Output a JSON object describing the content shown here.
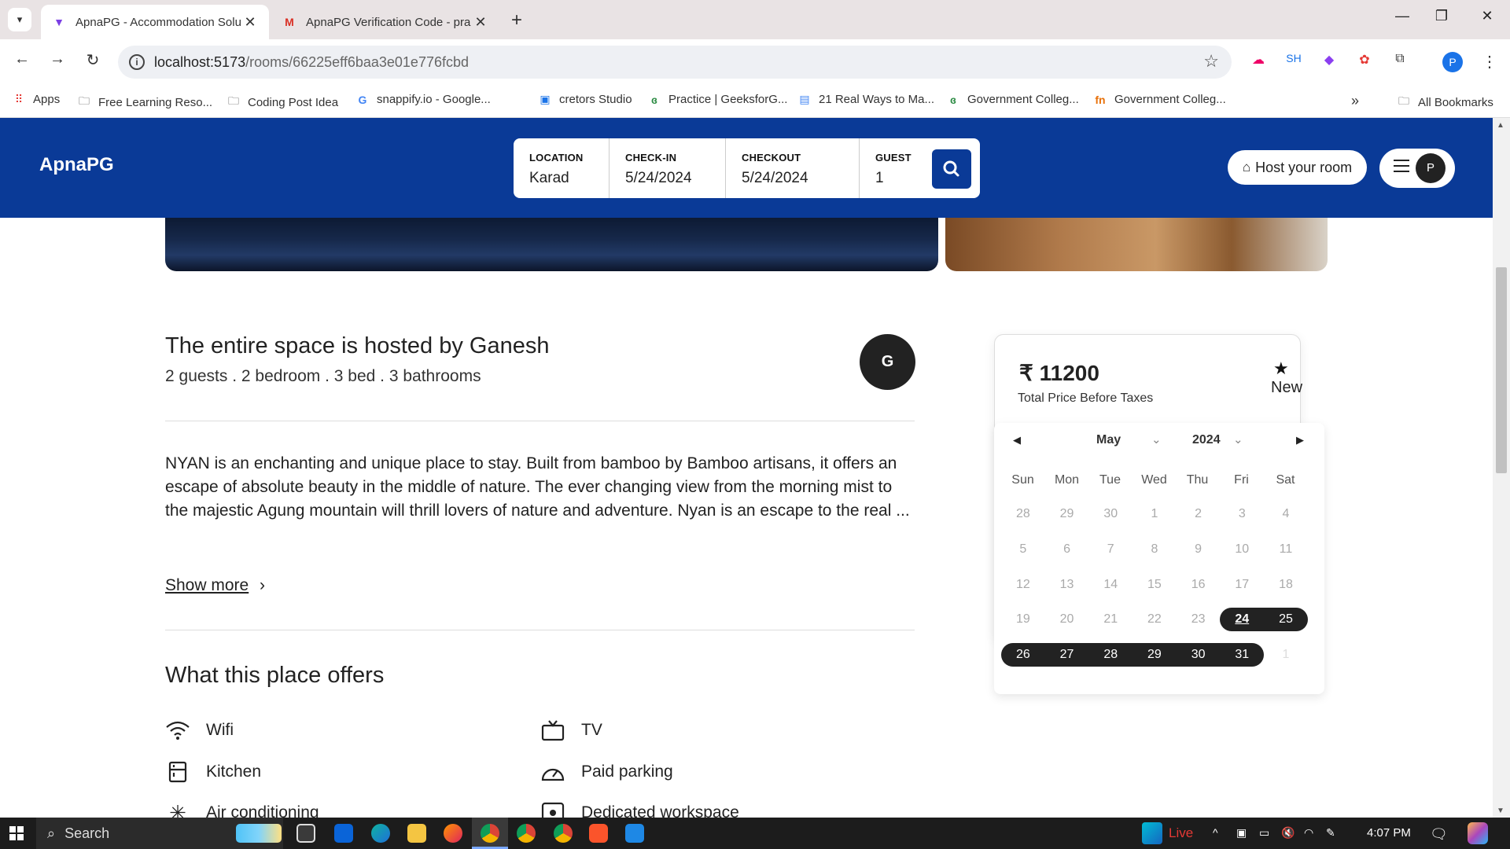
{
  "browser": {
    "tabs": [
      {
        "title": "ApnaPG - Accommodation Solu",
        "active": true
      },
      {
        "title": "ApnaPG Verification Code - pra",
        "active": false
      }
    ],
    "url_host": "localhost:5173",
    "url_path": "/rooms/66225eff6baa3e01e776fcbd",
    "ext_sh": "SH",
    "profile_initial": "P",
    "bookmarks": [
      "Apps",
      "Free Learning Reso...",
      "Coding Post Idea",
      "snappify.io - Google...",
      "cretors Studio",
      "Practice | GeeksforG...",
      "21 Real Ways to Ma...",
      "Government Colleg...",
      "Government Colleg..."
    ],
    "all_bookmarks": "All Bookmarks"
  },
  "header": {
    "logo": "ApnaPG",
    "search": {
      "location_label": "LOCATION",
      "location_value": "Karad",
      "checkin_label": "CHECK-IN",
      "checkin_value": "5/24/2024",
      "checkout_label": "CHECKOUT",
      "checkout_value": "5/24/2024",
      "guest_label": "GUEST",
      "guest_value": "1"
    },
    "host_button": "Host your room",
    "user_initial": "P"
  },
  "listing": {
    "host_title": "The entire space is hosted by Ganesh",
    "host_details": "2 guests . 2 bedroom . 3 bed . 3 bathrooms",
    "host_initial": "G",
    "description": "NYAN is an enchanting and unique place to stay. Built from bamboo by Bamboo artisans, it offers an escape of absolute beauty in the middle of nature. The ever changing view from the morning mist to the majestic Agung mountain will thrill lovers of nature and adventure. Nyan is an escape to the real ...",
    "show_more": "Show more",
    "offers_title": "What this place offers",
    "amenities": [
      "Wifi",
      "TV",
      "Kitchen",
      "Paid parking",
      "Air conditioning",
      "Dedicated workspace"
    ]
  },
  "booking": {
    "currency": "₹",
    "price": "11200",
    "price_note": "Total Price Before Taxes",
    "rating_label": "New"
  },
  "calendar": {
    "month": "May",
    "year": "2024",
    "weekdays": [
      "Sun",
      "Mon",
      "Tue",
      "Wed",
      "Thu",
      "Fri",
      "Sat"
    ],
    "weeks": [
      [
        "28",
        "29",
        "30",
        "1",
        "2",
        "3",
        "4"
      ],
      [
        "5",
        "6",
        "7",
        "8",
        "9",
        "10",
        "11"
      ],
      [
        "12",
        "13",
        "14",
        "15",
        "16",
        "17",
        "18"
      ],
      [
        "19",
        "20",
        "21",
        "22",
        "23",
        "24",
        "25"
      ],
      [
        "26",
        "27",
        "28",
        "29",
        "30",
        "31",
        "1"
      ]
    ]
  },
  "taskbar": {
    "search_placeholder": "Search",
    "live_label": "Live",
    "time": "4:07 PM"
  }
}
